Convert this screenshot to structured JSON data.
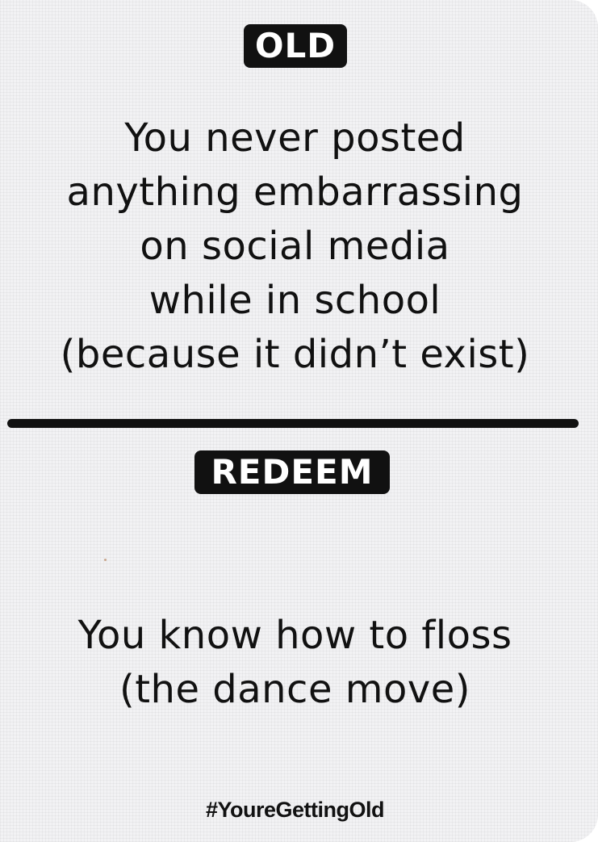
{
  "card": {
    "old_label": "OLD",
    "old_lines": [
      "You never posted",
      "anything embarrassing",
      "on social media",
      "while in school",
      "(because it didn’t exist)"
    ],
    "redeem_label": "REDEEM",
    "redeem_lines": [
      "You know how to floss",
      "(the dance move)"
    ],
    "hashtag": "#YoureGettingOld"
  },
  "colors": {
    "card_background": "#f2f2f4",
    "ink": "#111111",
    "badge_text": "#ffffff"
  }
}
